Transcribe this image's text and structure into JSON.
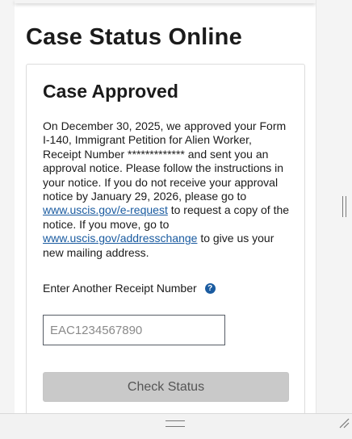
{
  "page": {
    "title": "Case Status Online"
  },
  "case": {
    "heading": "Case Approved",
    "status_part1": "On December 30, 2025, we approved your Form I-140, Immigrant Petition for Alien Worker, Receipt Number ",
    "masked_receipt": "*************",
    "status_part2": " and sent you an approval notice. Please follow the instructions in your notice. If you do not receive your approval notice by January 29, 2026, please go to ",
    "link_request": "www.uscis.gov/e-request",
    "status_part3": " to request a copy of the notice. If you move, go to ",
    "link_address": "www.uscis.gov/addresschange",
    "status_part4": " to give us your new mailing address."
  },
  "receipt_form": {
    "label": "Enter Another Receipt Number",
    "help_glyph": "?",
    "placeholder": "EAC1234567890",
    "value": "",
    "button_label": "Check Status"
  },
  "colors": {
    "link": "#1a5ba0",
    "help_icon": "#1a5ba0",
    "button_bg": "#c9c9c9",
    "text": "#1b1b1b"
  },
  "icons": {
    "help": "question-circle-icon",
    "splitter": "splitter-handle-icon",
    "grip": "drag-grip-icon",
    "resize": "resize-corner-icon"
  }
}
